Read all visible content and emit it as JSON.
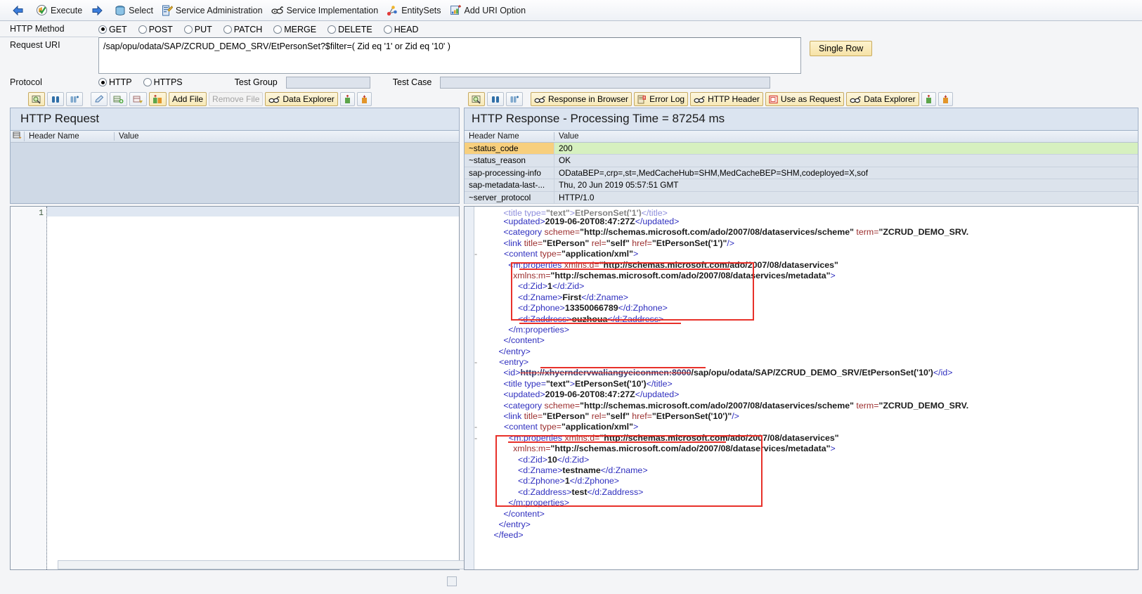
{
  "toolbar": {
    "items": [
      {
        "icon": "back-arrow-icon",
        "label": ""
      },
      {
        "icon": "execute-icon",
        "label": "Execute"
      },
      {
        "icon": "forward-arrow-icon",
        "label": ""
      },
      {
        "icon": "select-icon",
        "label": "Select"
      },
      {
        "icon": "service-administration-icon",
        "label": "Service Administration"
      },
      {
        "icon": "service-implementation-icon",
        "label": "Service Implementation"
      },
      {
        "icon": "entitysets-icon",
        "label": "EntitySets"
      },
      {
        "icon": "add-uri-option-icon",
        "label": "Add URI Option"
      }
    ]
  },
  "form": {
    "http_method_label": "HTTP Method",
    "methods": [
      "GET",
      "POST",
      "PUT",
      "PATCH",
      "MERGE",
      "DELETE",
      "HEAD"
    ],
    "method_selected": "GET",
    "request_uri_label": "Request URI",
    "request_uri_value": "/sap/opu/odata/SAP/ZCRUD_DEMO_SRV/EtPersonSet?$filter=( Zid eq '1' or Zid eq '10' )",
    "single_row_button": "Single Row",
    "protocol_label": "Protocol",
    "protocols": [
      "HTTP",
      "HTTPS"
    ],
    "protocol_selected": "HTTP",
    "test_group_label": "Test Group",
    "test_group_value": "",
    "test_case_label": "Test Case",
    "test_case_value": ""
  },
  "request_panel": {
    "toolbar_buttons": [
      {
        "name": "display-icon",
        "label": ""
      },
      {
        "name": "find-icon",
        "label": ""
      },
      {
        "name": "find-next-icon",
        "label": ""
      },
      {
        "name": "edit-icon",
        "label": ""
      },
      {
        "name": "insert-row-icon",
        "label": ""
      },
      {
        "name": "delete-row-icon",
        "label": ""
      },
      {
        "name": "upload-icon",
        "label": ""
      },
      {
        "name": "add-file-button",
        "label": "Add File"
      },
      {
        "name": "remove-file-button",
        "label": "Remove File"
      },
      {
        "name": "data-explorer-button",
        "label": "Data Explorer"
      },
      {
        "name": "import-icon",
        "label": ""
      },
      {
        "name": "export-icon",
        "label": ""
      }
    ],
    "title": "HTTP Request",
    "grid_headers": [
      "Header Name",
      "Value"
    ],
    "rows": []
  },
  "response_panel": {
    "toolbar_buttons": [
      {
        "name": "display-icon",
        "label": ""
      },
      {
        "name": "find-icon",
        "label": ""
      },
      {
        "name": "find-next-icon",
        "label": ""
      },
      {
        "name": "response-in-browser-button",
        "label": "Response in Browser"
      },
      {
        "name": "error-log-button",
        "label": "Error Log"
      },
      {
        "name": "http-header-button",
        "label": "HTTP Header"
      },
      {
        "name": "use-as-request-button",
        "label": "Use as Request"
      },
      {
        "name": "data-explorer-button",
        "label": "Data Explorer"
      },
      {
        "name": "import-icon",
        "label": ""
      },
      {
        "name": "export-icon",
        "label": ""
      }
    ],
    "title": "HTTP Response - Processing Time = 87254  ms",
    "grid_headers": [
      "Header Name",
      "Value"
    ],
    "rows": [
      {
        "key": "~status_code",
        "value": "200",
        "highlight": true
      },
      {
        "key": "~status_reason",
        "value": "OK",
        "highlight": false
      },
      {
        "key": "sap-processing-info",
        "value": "ODataBEP=,crp=,st=,MedCacheHub=SHM,MedCacheBEP=SHM,codeployed=X,sof",
        "highlight": false
      },
      {
        "key": "sap-metadata-last-...",
        "value": "Thu, 20 Jun 2019 05:57:51 GMT",
        "highlight": false
      },
      {
        "key": "~server_protocol",
        "value": "HTTP/1.0",
        "highlight": false
      }
    ]
  },
  "request_editor": {
    "line_numbers": [
      "1"
    ],
    "content": ""
  },
  "response_xml": {
    "lines": [
      {
        "indent": 6,
        "toggle": "",
        "segments": [
          {
            "t": "tg",
            "v": "<title type="
          },
          {
            "t": "av",
            "v": "\"text\""
          },
          {
            "t": "tg",
            "v": ">"
          },
          {
            "t": "tx",
            "v": "EtPersonSet('1')"
          },
          {
            "t": "tg",
            "v": "</title>"
          }
        ],
        "clipped_top": true
      },
      {
        "indent": 6,
        "toggle": "",
        "segments": [
          {
            "t": "tg",
            "v": "<updated>"
          },
          {
            "t": "tx",
            "v": "2019-06-20T08:47:27Z"
          },
          {
            "t": "tg",
            "v": "</updated>"
          }
        ]
      },
      {
        "indent": 6,
        "toggle": "",
        "segments": [
          {
            "t": "tg",
            "v": "<category "
          },
          {
            "t": "an",
            "v": "scheme="
          },
          {
            "t": "av",
            "v": "\"http://schemas.microsoft.com/ado/2007/08/dataservices/scheme\""
          },
          {
            "t": "an",
            "v": " term="
          },
          {
            "t": "av",
            "v": "\"ZCRUD_DEMO_SRV."
          }
        ]
      },
      {
        "indent": 6,
        "toggle": "",
        "segments": [
          {
            "t": "tg",
            "v": "<link "
          },
          {
            "t": "an",
            "v": "title="
          },
          {
            "t": "av",
            "v": "\"EtPerson\""
          },
          {
            "t": "an",
            "v": " rel="
          },
          {
            "t": "av",
            "v": "\"self\""
          },
          {
            "t": "an",
            "v": " href="
          },
          {
            "t": "av",
            "v": "\"EtPersonSet('1')\""
          },
          {
            "t": "tg",
            "v": "/>"
          }
        ]
      },
      {
        "indent": 5,
        "toggle": "-",
        "segments": [
          {
            "t": "tg",
            "v": "<content "
          },
          {
            "t": "an",
            "v": "type="
          },
          {
            "t": "av",
            "v": "\"application/xml\""
          },
          {
            "t": "tg",
            "v": ">"
          }
        ]
      },
      {
        "indent": 7,
        "toggle": "",
        "redacted": true,
        "segments": [
          {
            "t": "tg",
            "v": "<m:properties "
          },
          {
            "t": "an",
            "v": "xmlns:d="
          },
          {
            "t": "av",
            "v": "\"http://schemas.microsoft.com/ado/2007/08/dataservices\""
          }
        ]
      },
      {
        "indent": 8,
        "toggle": "",
        "segments": [
          {
            "t": "an",
            "v": "xmlns:m="
          },
          {
            "t": "av",
            "v": "\"http://schemas.microsoft.com/ado/2007/08/dataservices/metadata\""
          },
          {
            "t": "tg",
            "v": ">"
          }
        ]
      },
      {
        "indent": 9,
        "toggle": "",
        "segments": [
          {
            "t": "tg",
            "v": "<d:Zid>"
          },
          {
            "t": "tx",
            "v": "1"
          },
          {
            "t": "tg",
            "v": "</d:Zid>"
          }
        ]
      },
      {
        "indent": 9,
        "toggle": "",
        "segments": [
          {
            "t": "tg",
            "v": "<d:Zname>"
          },
          {
            "t": "tx",
            "v": "First"
          },
          {
            "t": "tg",
            "v": "</d:Zname>"
          }
        ]
      },
      {
        "indent": 9,
        "toggle": "",
        "segments": [
          {
            "t": "tg",
            "v": "<d:Zphone>"
          },
          {
            "t": "tx",
            "v": "13350066789"
          },
          {
            "t": "tg",
            "v": "</d:Zphone>"
          }
        ]
      },
      {
        "indent": 9,
        "toggle": "",
        "segments": [
          {
            "t": "tg",
            "v": "<d:Zaddress>"
          },
          {
            "t": "tx",
            "v": "ouzhoua"
          },
          {
            "t": "tg",
            "v": "</d:Zaddress>"
          }
        ]
      },
      {
        "indent": 7,
        "toggle": "",
        "redacted": true,
        "segments": [
          {
            "t": "tg",
            "v": "</m:properties>"
          }
        ]
      },
      {
        "indent": 6,
        "toggle": "",
        "segments": [
          {
            "t": "tg",
            "v": "</content>"
          }
        ]
      },
      {
        "indent": 5,
        "toggle": "",
        "segments": [
          {
            "t": "tg",
            "v": "</entry>"
          }
        ]
      },
      {
        "indent": 4,
        "toggle": "-",
        "segments": [
          {
            "t": "tg",
            "v": "<entry>"
          }
        ]
      },
      {
        "indent": 6,
        "toggle": "",
        "segments": [
          {
            "t": "tg",
            "v": "<id>"
          },
          {
            "t": "redact",
            "v": "http://xhyerndervwaliangyeiconmen:8000"
          },
          {
            "t": "tx",
            "v": "/sap/opu/odata/SAP/ZCRUD_DEMO_SRV/EtPersonSet('10')"
          },
          {
            "t": "tg",
            "v": "</id>"
          }
        ]
      },
      {
        "indent": 6,
        "toggle": "",
        "segments": [
          {
            "t": "tg",
            "v": "<title type="
          },
          {
            "t": "av",
            "v": "\"text\""
          },
          {
            "t": "tg",
            "v": ">"
          },
          {
            "t": "tx",
            "v": "EtPersonSet('10')"
          },
          {
            "t": "tg",
            "v": "</title>"
          }
        ]
      },
      {
        "indent": 6,
        "toggle": "",
        "segments": [
          {
            "t": "tg",
            "v": "<updated>"
          },
          {
            "t": "tx",
            "v": "2019-06-20T08:47:27Z"
          },
          {
            "t": "tg",
            "v": "</updated>"
          }
        ]
      },
      {
        "indent": 6,
        "toggle": "",
        "segments": [
          {
            "t": "tg",
            "v": "<category "
          },
          {
            "t": "an",
            "v": "scheme="
          },
          {
            "t": "av",
            "v": "\"http://schemas.microsoft.com/ado/2007/08/dataservices/scheme\""
          },
          {
            "t": "an",
            "v": " term="
          },
          {
            "t": "av",
            "v": "\"ZCRUD_DEMO_SRV."
          }
        ]
      },
      {
        "indent": 6,
        "toggle": "",
        "segments": [
          {
            "t": "tg",
            "v": "<link "
          },
          {
            "t": "an",
            "v": "title="
          },
          {
            "t": "av",
            "v": "\"EtPerson\""
          },
          {
            "t": "an",
            "v": " rel="
          },
          {
            "t": "av",
            "v": "\"self\""
          },
          {
            "t": "an",
            "v": " href="
          },
          {
            "t": "av",
            "v": "\"EtPersonSet('10')\""
          },
          {
            "t": "tg",
            "v": "/>"
          }
        ]
      },
      {
        "indent": 5,
        "toggle": "-",
        "segments": [
          {
            "t": "tg",
            "v": "<content "
          },
          {
            "t": "an",
            "v": "type="
          },
          {
            "t": "av",
            "v": "\"application/xml\""
          },
          {
            "t": "tg",
            "v": ">"
          }
        ]
      },
      {
        "indent": 6,
        "toggle": "-",
        "redacted": true,
        "segments": [
          {
            "t": "tg",
            "v": "<m:properties "
          },
          {
            "t": "an",
            "v": "xmlns:d="
          },
          {
            "t": "av",
            "v": "\"http://schemas.microsoft.com/ado/2007/08/dataservices\""
          }
        ]
      },
      {
        "indent": 8,
        "toggle": "",
        "segments": [
          {
            "t": "an",
            "v": "xmlns:m="
          },
          {
            "t": "av",
            "v": "\"http://schemas.microsoft.com/ado/2007/08/dataservices/metadata\""
          },
          {
            "t": "tg",
            "v": ">"
          }
        ]
      },
      {
        "indent": 9,
        "toggle": "",
        "segments": [
          {
            "t": "tg",
            "v": "<d:Zid>"
          },
          {
            "t": "tx",
            "v": "10"
          },
          {
            "t": "tg",
            "v": "</d:Zid>"
          }
        ]
      },
      {
        "indent": 9,
        "toggle": "",
        "segments": [
          {
            "t": "tg",
            "v": "<d:Zname>"
          },
          {
            "t": "tx",
            "v": "testname"
          },
          {
            "t": "tg",
            "v": "</d:Zname>"
          }
        ]
      },
      {
        "indent": 9,
        "toggle": "",
        "segments": [
          {
            "t": "tg",
            "v": "<d:Zphone>"
          },
          {
            "t": "tx",
            "v": "1"
          },
          {
            "t": "tg",
            "v": "</d:Zphone>"
          }
        ]
      },
      {
        "indent": 9,
        "toggle": "",
        "segments": [
          {
            "t": "tg",
            "v": "<d:Zaddress>"
          },
          {
            "t": "tx",
            "v": "test"
          },
          {
            "t": "tg",
            "v": "</d:Zaddress>"
          }
        ]
      },
      {
        "indent": 7,
        "toggle": "",
        "segments": [
          {
            "t": "tg",
            "v": "</m:properties>"
          }
        ]
      },
      {
        "indent": 6,
        "toggle": "",
        "segments": [
          {
            "t": "tg",
            "v": "</content>"
          }
        ]
      },
      {
        "indent": 5,
        "toggle": "",
        "segments": [
          {
            "t": "tg",
            "v": "</entry>"
          }
        ]
      },
      {
        "indent": 4,
        "toggle": "",
        "segments": [
          {
            "t": "tg",
            "v": "</feed>"
          }
        ]
      }
    ]
  },
  "colors": {
    "accent_yellow": "#f7e9b7",
    "status_key_bg": "#f7cf7d",
    "status_value_bg": "#d6f0bf",
    "annotation_red": "#e8312a",
    "panel_header_blue": "#dbe4f0"
  }
}
